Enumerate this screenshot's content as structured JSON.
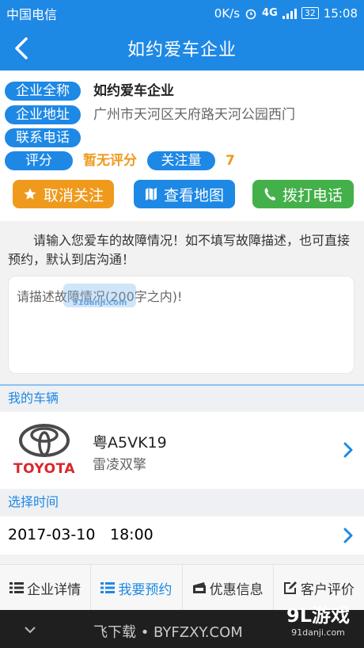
{
  "status_bar": {
    "carrier": "中国电信",
    "speed": "0K/s",
    "network": "4G",
    "battery": "32",
    "time": "15:08"
  },
  "nav": {
    "title": "如约爱车企业"
  },
  "company": {
    "name_label": "企业全称",
    "name": "如约爱车企业",
    "address_label": "企业地址",
    "address": "广州市天河区天府路天河公园西门",
    "phone_label": "联系电话",
    "rating_label": "评分",
    "rating": "暂无评分",
    "follows_label": "关注量",
    "follows": "7"
  },
  "actions": {
    "unfollow": "取消关注",
    "map": "查看地图",
    "call": "拨打电话"
  },
  "colors": {
    "primary": "#1e88e5",
    "unfollow": "#ef9a1d",
    "map": "#1e88e5",
    "call": "#43b049",
    "rating": "#ef9a1d"
  },
  "fault": {
    "hint": "请输入您爱车的故障情况！如不填写故障描述，也可直接预约，默认到店沟通！",
    "placeholder": "请描述故障情况(200字之内)!"
  },
  "vehicle": {
    "section_title": "我的车辆",
    "brand_logo": "TOYOTA",
    "plate": "粤A5VK19",
    "model": "雷凌双擎"
  },
  "time": {
    "section_title": "选择时间",
    "date": "2017-03-10",
    "clock": "18:00"
  },
  "tabs": [
    {
      "label": "企业详情",
      "icon": "list-icon"
    },
    {
      "label": "我要预约",
      "icon": "list-icon",
      "active": true
    },
    {
      "label": "优惠信息",
      "icon": "ticket-icon"
    },
    {
      "label": "客户评价",
      "icon": "edit-icon"
    }
  ],
  "watermarks": {
    "center": "飞下载 • BYFZXY.COM",
    "brand": "9L游戏",
    "brand_url": "91danji.com",
    "overlay": "91danji.com"
  }
}
